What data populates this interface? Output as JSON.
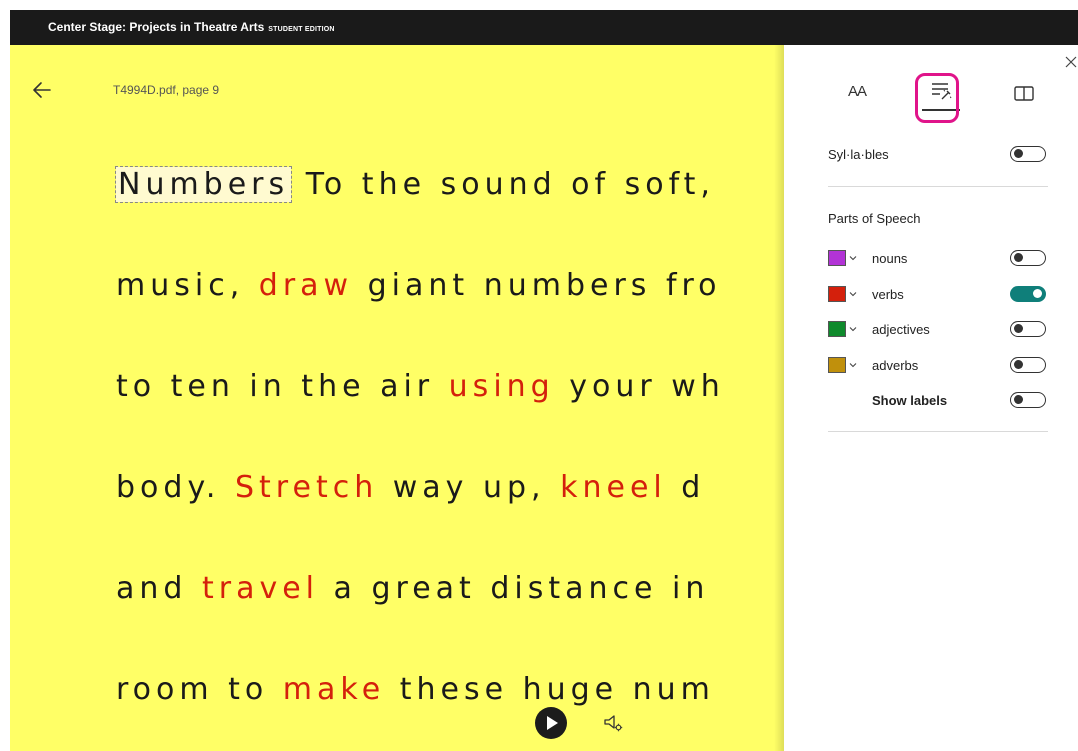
{
  "app": {
    "title": "Center Stage: Projects in Theatre Arts",
    "edition": "STUDENT EDITION"
  },
  "reader": {
    "filename": "T4994D.pdf, page 9",
    "lines": [
      [
        {
          "t": "Numbers",
          "k": "hl"
        },
        {
          "t": " To the sound of soft,",
          "k": ""
        }
      ],
      [
        {
          "t": "music, ",
          "k": ""
        },
        {
          "t": "draw",
          "k": "verb"
        },
        {
          "t": " giant numbers fro",
          "k": ""
        }
      ],
      [
        {
          "t": "to ten in the air ",
          "k": ""
        },
        {
          "t": "using",
          "k": "verb"
        },
        {
          "t": " your wh",
          "k": ""
        }
      ],
      [
        {
          "t": "body. ",
          "k": ""
        },
        {
          "t": "Stretch",
          "k": "verb"
        },
        {
          "t": " way up, ",
          "k": ""
        },
        {
          "t": "kneel",
          "k": "verb"
        },
        {
          "t": " d",
          "k": ""
        }
      ],
      [
        {
          "t": "and ",
          "k": ""
        },
        {
          "t": "travel",
          "k": "verb"
        },
        {
          "t": " a great distance in",
          "k": ""
        }
      ],
      [
        {
          "t": "room to ",
          "k": ""
        },
        {
          "t": "make",
          "k": "verb"
        },
        {
          "t": " these huge num",
          "k": ""
        }
      ]
    ]
  },
  "panel": {
    "tabs": [
      {
        "label": "AA",
        "icon": "text-size-icon"
      },
      {
        "icon": "grammar-tools-icon",
        "selected": true
      },
      {
        "icon": "reading-preferences-icon"
      }
    ],
    "syllables": {
      "label": "Syl·la·bles",
      "on": false
    },
    "parts_of_speech_title": "Parts of Speech",
    "parts": [
      {
        "label": "nouns",
        "color": "#b233d6",
        "on": false
      },
      {
        "label": "verbs",
        "color": "#d4200c",
        "on": true
      },
      {
        "label": "adjectives",
        "color": "#0f8a2c",
        "on": false
      },
      {
        "label": "adverbs",
        "color": "#c0900c",
        "on": false
      }
    ],
    "show_labels": {
      "label": "Show labels",
      "on": false
    }
  },
  "colors": {
    "reader_bg": "#ffff66",
    "verb": "#d4200c",
    "toggle_on": "#0f7f7a",
    "focus_ring": "#e0148a"
  }
}
